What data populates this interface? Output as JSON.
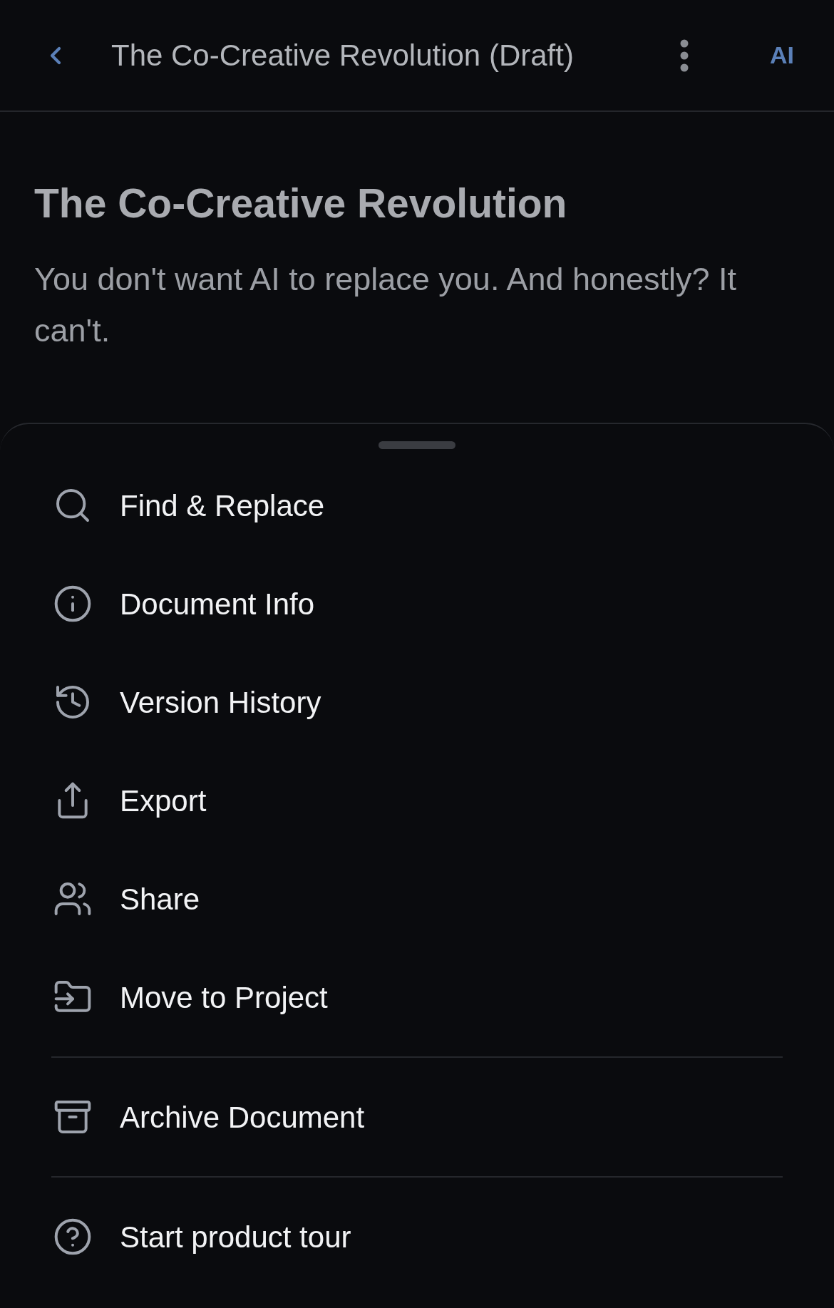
{
  "header": {
    "title": "The Co-Creative Revolution (Draft)",
    "ai_button": "AI"
  },
  "document": {
    "heading": "The Co-Creative Revolution",
    "paragraphs": [
      "You don't want AI to replace you. And honestly? It can't."
    ]
  },
  "menu_groups": [
    {
      "items": [
        "Find & Replace",
        "Document Info",
        "Version History",
        "Export",
        "Share",
        "Move to Project"
      ]
    },
    {
      "items": [
        "Archive Document"
      ]
    },
    {
      "items": [
        "Start product tour"
      ]
    }
  ]
}
